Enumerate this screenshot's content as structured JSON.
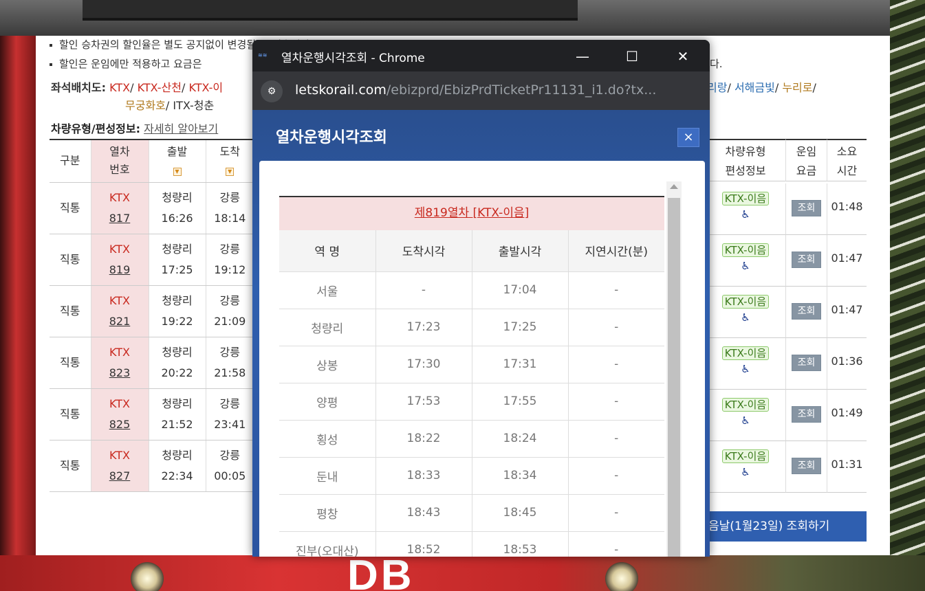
{
  "notes": [
    "할인 승차권의 할인율은 별도 공지없이 변경될 수 있습니다.",
    "할인은 운임에만 적용하고 요금은",
    "다."
  ],
  "seat_map": {
    "label": "좌석배치도:",
    "items_left": [
      "KTX",
      "KTX-산천",
      "KTX-이"
    ],
    "items_right": [
      "리랑",
      "서해금빛",
      "누리로"
    ],
    "items_line2": [
      "무궁화호",
      "ITX-청춘"
    ],
    "sep": "/"
  },
  "vehicle_info": {
    "label": "차량유형/편성정보:",
    "link": "자세히 알아보기"
  },
  "table": {
    "headers": {
      "gubun": "구분",
      "train_no_1": "열차",
      "train_no_2": "번호",
      "dep": "출발",
      "arr": "도착",
      "vehicle_1": "차량유형",
      "vehicle_2": "편성정보",
      "fare_1": "운임",
      "fare_2": "요금",
      "dur_1": "소요",
      "dur_2": "시간"
    },
    "rows": [
      {
        "type": "직통",
        "train": "KTX",
        "no": "817",
        "dep_st": "청량리",
        "dep_t": "16:26",
        "arr_st": "강릉",
        "arr_t": "18:14",
        "vehicle": "KTX-이음",
        "fare": "조회",
        "dur": "01:48"
      },
      {
        "type": "직통",
        "train": "KTX",
        "no": "819",
        "dep_st": "청량리",
        "dep_t": "17:25",
        "arr_st": "강릉",
        "arr_t": "19:12",
        "vehicle": "KTX-이음",
        "fare": "조회",
        "dur": "01:47"
      },
      {
        "type": "직통",
        "train": "KTX",
        "no": "821",
        "dep_st": "청량리",
        "dep_t": "19:22",
        "arr_st": "강릉",
        "arr_t": "21:09",
        "vehicle": "KTX-이음",
        "fare": "조회",
        "dur": "01:47"
      },
      {
        "type": "직통",
        "train": "KTX",
        "no": "823",
        "dep_st": "청량리",
        "dep_t": "20:22",
        "arr_st": "강릉",
        "arr_t": "21:58",
        "vehicle": "KTX-이음",
        "fare": "조회",
        "dur": "01:36"
      },
      {
        "type": "직통",
        "train": "KTX",
        "no": "825",
        "dep_st": "청량리",
        "dep_t": "21:52",
        "arr_st": "강릉",
        "arr_t": "23:41",
        "vehicle": "KTX-이음",
        "fare": "조회",
        "dur": "01:49"
      },
      {
        "type": "직통",
        "train": "KTX",
        "no": "827",
        "dep_st": "청량리",
        "dep_t": "22:34",
        "arr_st": "강릉",
        "arr_t": "00:05",
        "vehicle": "KTX-이음",
        "fare": "조회",
        "dur": "01:31"
      }
    ]
  },
  "next_day_button": "음날(1월23일) 조회하기",
  "popup": {
    "window_title": "열차운행시각조회 - Chrome",
    "url_host": "letskorail.com",
    "url_path": "/ebizprd/EbizPrdTicketPr11131_i1.do?tx...",
    "header": "열차운행시각조회",
    "close": "×",
    "schedule_title": "제819열차 [KTX-이음]",
    "columns": [
      "역 명",
      "도착시각",
      "출발시각",
      "지연시간(분)"
    ],
    "stops": [
      {
        "station": "서울",
        "arr": "-",
        "dep": "17:04",
        "delay": "-"
      },
      {
        "station": "청량리",
        "arr": "17:23",
        "dep": "17:25",
        "delay": "-"
      },
      {
        "station": "상봉",
        "arr": "17:30",
        "dep": "17:31",
        "delay": "-"
      },
      {
        "station": "양평",
        "arr": "17:53",
        "dep": "17:55",
        "delay": "-"
      },
      {
        "station": "횡성",
        "arr": "18:22",
        "dep": "18:24",
        "delay": "-"
      },
      {
        "station": "둔내",
        "arr": "18:33",
        "dep": "18:34",
        "delay": "-"
      },
      {
        "station": "평창",
        "arr": "18:43",
        "dep": "18:45",
        "delay": "-"
      },
      {
        "station": "진부(오대산)",
        "arr": "18:52",
        "dep": "18:53",
        "delay": "-"
      }
    ]
  },
  "background": {
    "logo_text": "DB"
  },
  "icons": {
    "sort": "sort-dropdown-icon",
    "wheelchair": "wheelchair-icon",
    "minimize": "minimize-icon",
    "maximize": "maximize-icon",
    "close": "close-icon",
    "site_settings": "tune-icon"
  }
}
